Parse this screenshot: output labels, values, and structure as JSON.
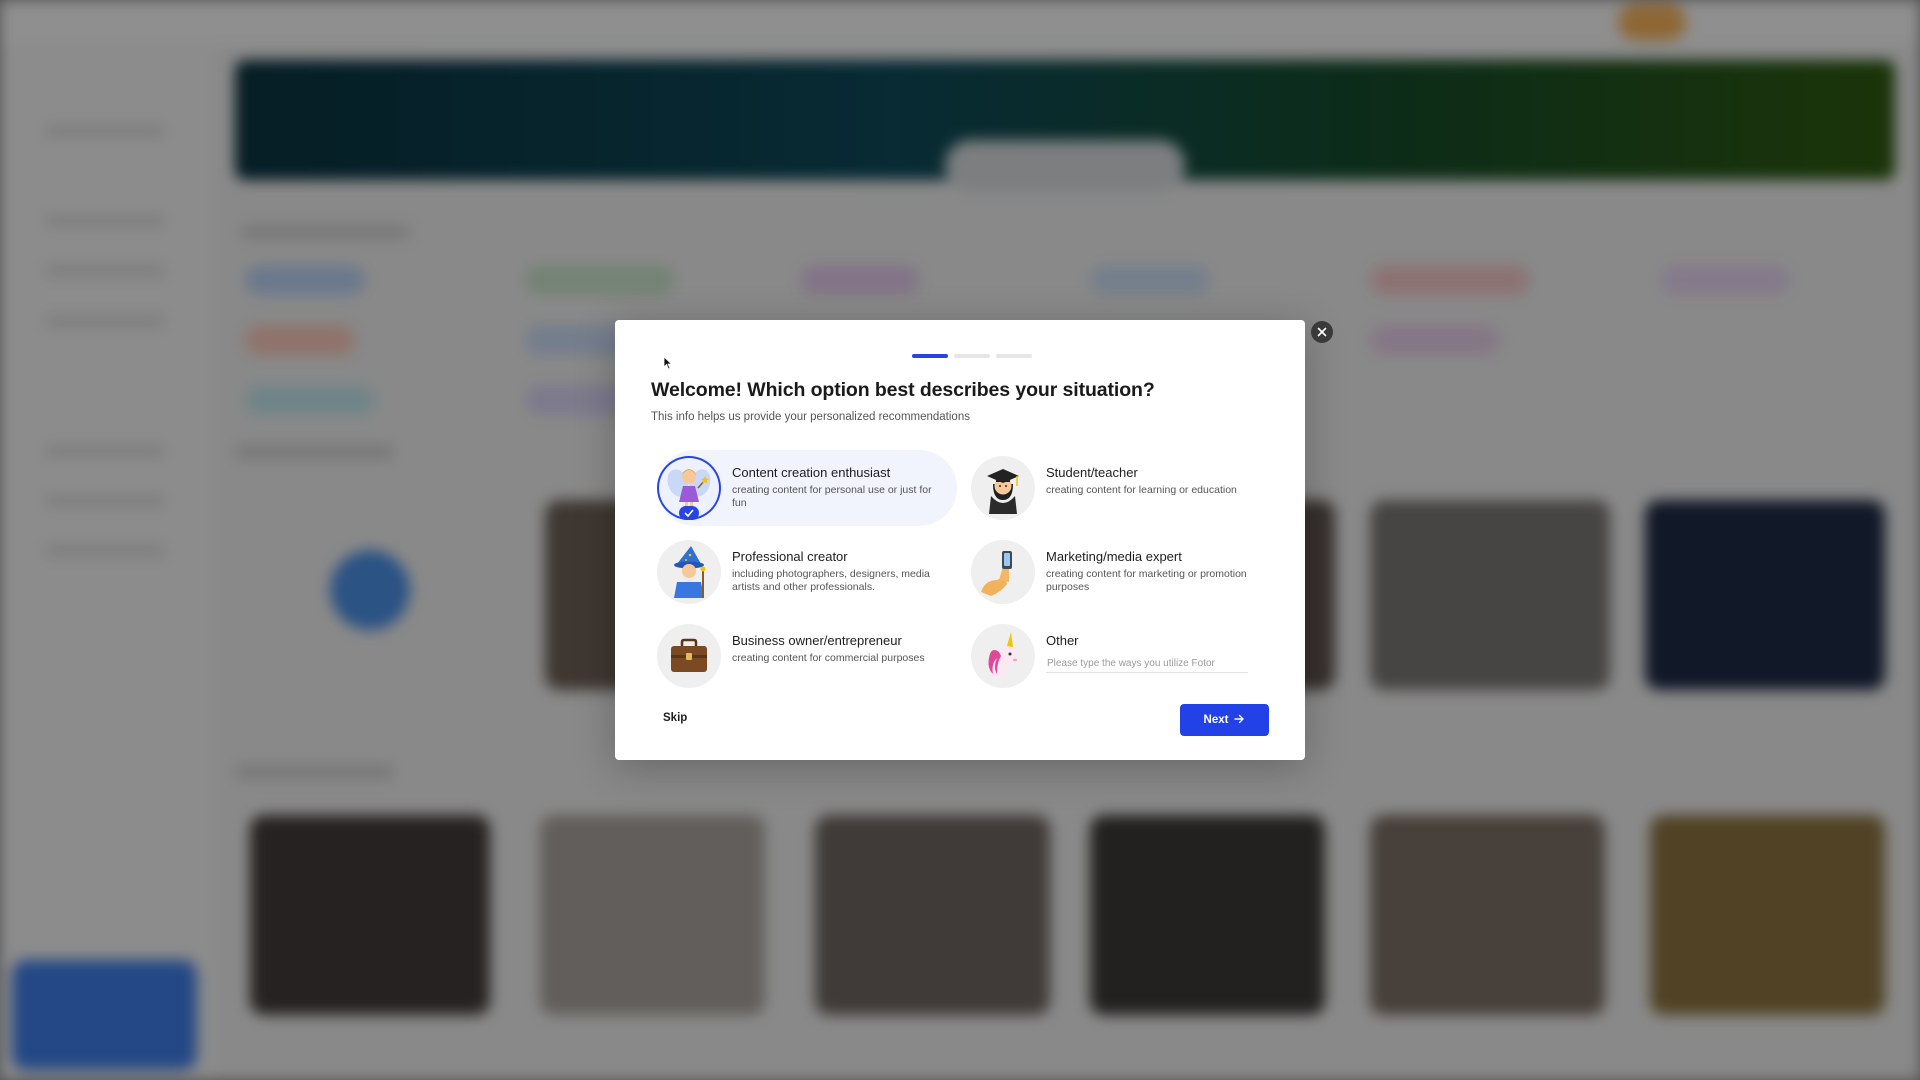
{
  "modal": {
    "title": "Welcome!  Which option best describes your situation?",
    "subtitle": "This info helps us provide your personalized recommendations",
    "progress": {
      "current_step": 1,
      "total_steps": 3
    },
    "options": [
      {
        "title": "Content creation enthusiast",
        "description": "creating content for personal use or just for fun",
        "icon": "fairy-icon",
        "selected": true
      },
      {
        "title": "Student/teacher",
        "description": "creating content for learning or education",
        "icon": "student-icon",
        "selected": false
      },
      {
        "title": "Professional creator",
        "description": "including photographers, designers, media artists and other professionals.",
        "icon": "wizard-icon",
        "selected": false
      },
      {
        "title": "Marketing/media expert",
        "description": "creating content for marketing or promotion purposes",
        "icon": "selfie-icon",
        "selected": false
      },
      {
        "title": "Business owner/entrepreneur",
        "description": "creating content for commercial purposes",
        "icon": "briefcase-icon",
        "selected": false
      },
      {
        "title": "Other",
        "placeholder": "Please type the ways you utilize Fotor",
        "value": "",
        "icon": "unicorn-icon",
        "selected": false
      }
    ],
    "skip_label": "Skip",
    "next_label": "Next",
    "accent_color": "#2845e4"
  }
}
